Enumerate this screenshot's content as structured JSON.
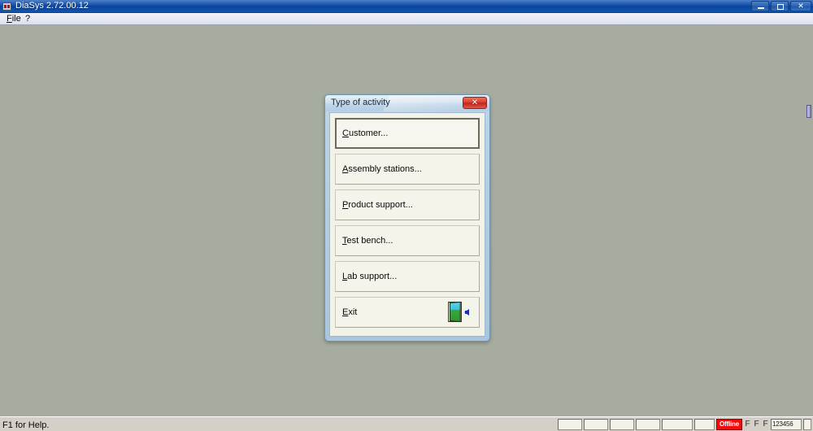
{
  "window": {
    "title": "DiaSys 2.72.00.12",
    "icon": "app-icon",
    "controls": {
      "minimize_label": "Minimize",
      "restore_label": "Restore",
      "close_label": "✕"
    }
  },
  "menubar": {
    "items": [
      {
        "label": "File",
        "accel": "F"
      },
      {
        "label": "?",
        "accel": ""
      }
    ]
  },
  "dialog": {
    "title": "Type of activity",
    "close_label": "✕",
    "buttons": [
      {
        "accel": "C",
        "rest": "ustomer...",
        "focused": true,
        "icon": ""
      },
      {
        "accel": "A",
        "rest": "ssembly stations...",
        "focused": false,
        "icon": ""
      },
      {
        "accel": "P",
        "rest": "roduct support...",
        "focused": false,
        "icon": ""
      },
      {
        "accel": "T",
        "rest": "est bench...",
        "focused": false,
        "icon": ""
      },
      {
        "accel": "L",
        "rest": "ab support...",
        "focused": false,
        "icon": ""
      },
      {
        "accel": "E",
        "rest": "xit",
        "focused": false,
        "icon": "exit-door-icon"
      }
    ]
  },
  "statusbar": {
    "hint": "F1 for Help.",
    "panels": [
      "",
      "",
      "",
      "",
      "",
      ""
    ],
    "connection": "Offline",
    "flags": [
      "F",
      "F",
      "F"
    ],
    "number": "123456"
  },
  "colors": {
    "desktop": "#a6ada0",
    "titlebar": "#0b4ba8",
    "dialog_face": "#b9d2e6",
    "button_face": "#f4f4ea",
    "offline_badge": "#f40a0a"
  }
}
